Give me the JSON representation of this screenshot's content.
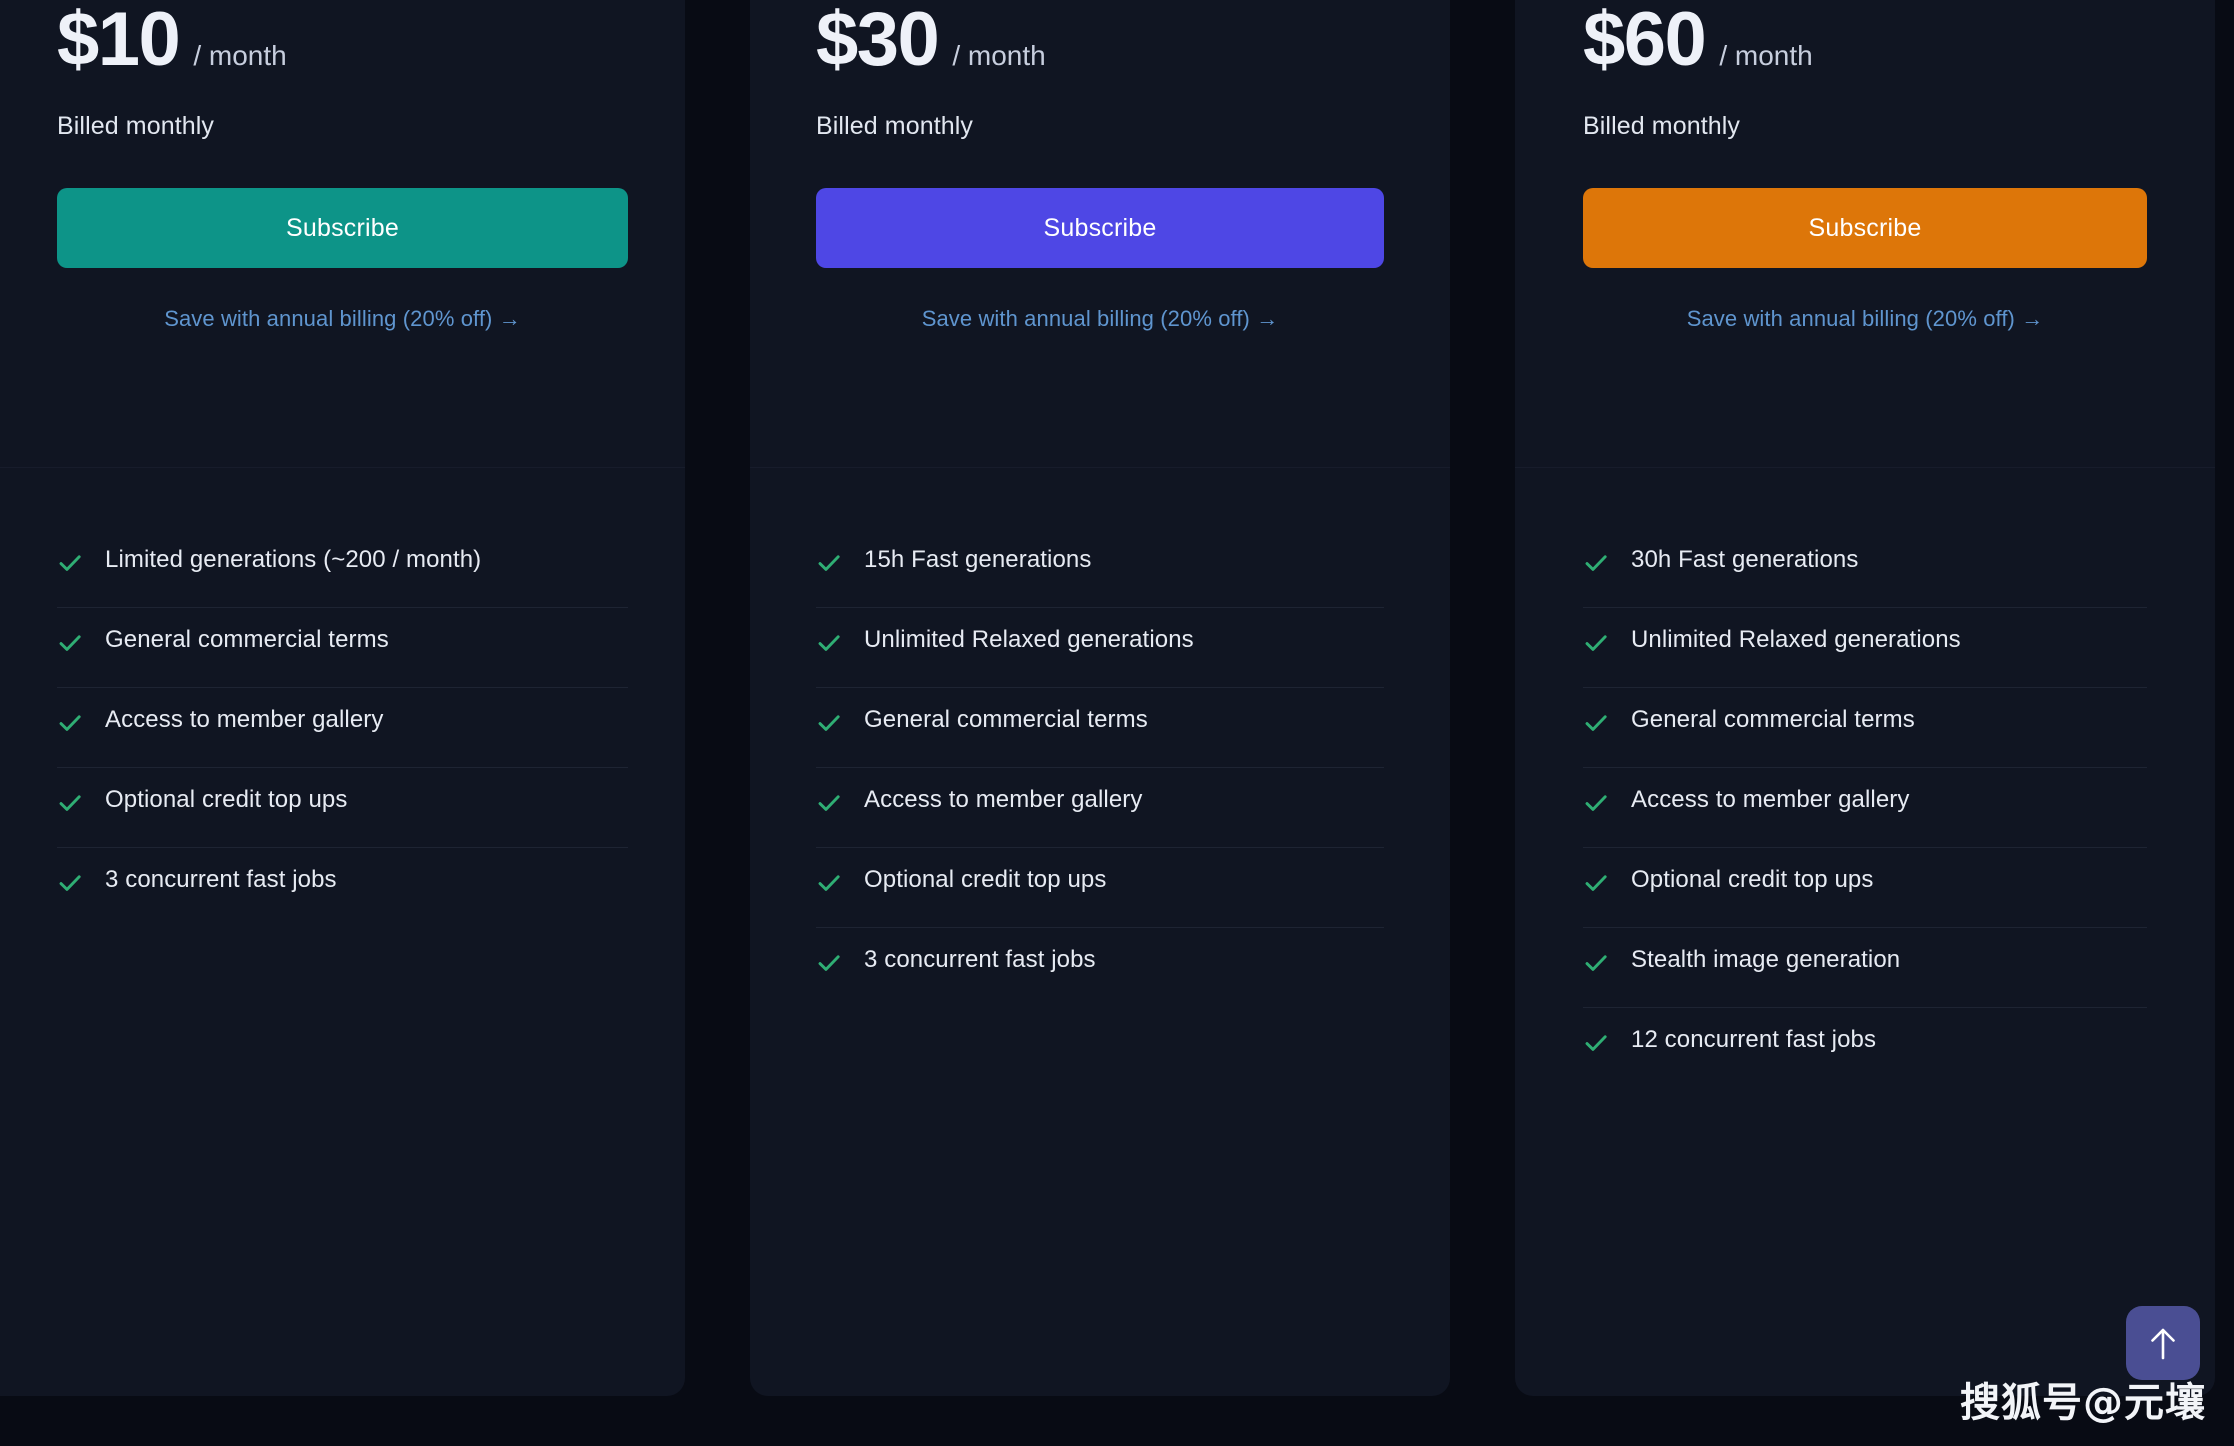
{
  "colors": {
    "page_background": "#080b14",
    "card_background": "#101522",
    "accent_basic": "#0d9488",
    "accent_standard": "#4e47e5",
    "accent_pro": "#dd7609",
    "check_green": "#2fae74",
    "link_blue": "#5f95cf",
    "scroll_button": "#4a4e93"
  },
  "plans": [
    {
      "price": "$10",
      "period": "/ month",
      "billing_note": "Billed monthly",
      "subscribe_label": "Subscribe",
      "annual_link_label": "Save with annual billing (20% off) →",
      "accent": "#0d9488",
      "features": [
        "Limited generations (~200 / month)",
        "General commercial terms",
        "Access to member gallery",
        "Optional credit top ups",
        "3 concurrent fast jobs"
      ]
    },
    {
      "price": "$30",
      "period": "/ month",
      "billing_note": "Billed monthly",
      "subscribe_label": "Subscribe",
      "annual_link_label": "Save with annual billing (20% off) →",
      "accent": "#4e47e5",
      "features": [
        "15h Fast generations",
        "Unlimited Relaxed generations",
        "General commercial terms",
        "Access to member gallery",
        "Optional credit top ups",
        "3 concurrent fast jobs"
      ]
    },
    {
      "price": "$60",
      "period": "/ month",
      "billing_note": "Billed monthly",
      "subscribe_label": "Subscribe",
      "annual_link_label": "Save with annual billing (20% off) →",
      "accent": "#dd7609",
      "features": [
        "30h Fast generations",
        "Unlimited Relaxed generations",
        "General commercial terms",
        "Access to member gallery",
        "Optional credit top ups",
        "Stealth image generation",
        "12 concurrent fast jobs"
      ]
    }
  ],
  "scroll_top": {
    "icon": "arrow-up-icon"
  },
  "watermark": {
    "text": "搜狐号@元壤"
  }
}
